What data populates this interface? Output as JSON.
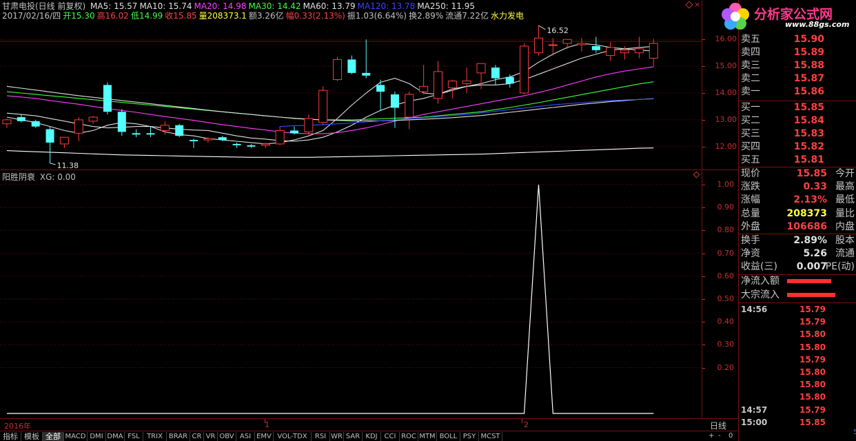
{
  "header": {
    "stock_name": "甘肃电投(日线 前复权)",
    "ma": [
      {
        "label": "MA5: 15.57",
        "color": "#e0e0e0"
      },
      {
        "label": "MA10: 15.74",
        "color": "#e0e0e0"
      },
      {
        "label": "MA20: 14.98",
        "color": "#ff40ff"
      },
      {
        "label": "MA30: 14.42",
        "color": "#40ff40"
      },
      {
        "label": "MA60: 13.79",
        "color": "#e0e0e0"
      },
      {
        "label": "MA120: 13.78",
        "color": "#4040ff"
      },
      {
        "label": "MA250: 11.95",
        "color": "#e0e0e0"
      }
    ],
    "line2": [
      {
        "label": "2017/02/16/四",
        "color": "#c0c0c0"
      },
      {
        "label": "开15.30",
        "color": "#40ff40"
      },
      {
        "label": "高16.02",
        "color": "#ff4040"
      },
      {
        "label": "低14.99",
        "color": "#40ff40"
      },
      {
        "label": "收15.85",
        "color": "#ff4040"
      },
      {
        "label": "量208373.1",
        "color": "#ffff40"
      },
      {
        "label": "额3.26亿",
        "color": "#c0c0c0"
      },
      {
        "label": "幅0.33(2.13%)",
        "color": "#ff4040"
      },
      {
        "label": "振1.03(6.64%)",
        "color": "#c0c0c0"
      },
      {
        "label": "换2.89%",
        "color": "#c0c0c0"
      },
      {
        "label": "流通7.22亿",
        "color": "#c0c0c0"
      },
      {
        "label": "水力发电",
        "color": "#ffff40"
      }
    ]
  },
  "main_chart": {
    "y_ticks": [
      "16.00",
      "15.00",
      "14.00",
      "13.00",
      "12.00"
    ],
    "y_range": [
      11.3,
      16.7
    ],
    "max_label": "16.52",
    "min_label": "11.38",
    "candles": [
      {
        "o": 12.85,
        "h": 13.05,
        "l": 12.7,
        "c": 13.0
      },
      {
        "o": 13.1,
        "h": 13.2,
        "l": 12.9,
        "c": 12.95
      },
      {
        "o": 12.95,
        "h": 13.0,
        "l": 12.7,
        "c": 12.75
      },
      {
        "o": 12.65,
        "h": 12.75,
        "l": 11.38,
        "c": 12.15
      },
      {
        "o": 12.1,
        "h": 12.3,
        "l": 11.95,
        "c": 12.35
      },
      {
        "o": 12.5,
        "h": 13.1,
        "l": 12.2,
        "c": 13.0
      },
      {
        "o": 12.95,
        "h": 13.15,
        "l": 12.85,
        "c": 13.1
      },
      {
        "o": 14.3,
        "h": 14.4,
        "l": 13.2,
        "c": 13.3
      },
      {
        "o": 13.3,
        "h": 13.4,
        "l": 12.4,
        "c": 12.55
      },
      {
        "o": 12.5,
        "h": 12.65,
        "l": 12.35,
        "c": 12.45
      },
      {
        "o": 12.5,
        "h": 12.75,
        "l": 12.35,
        "c": 12.45
      },
      {
        "o": 12.6,
        "h": 12.95,
        "l": 12.45,
        "c": 12.8
      },
      {
        "o": 12.8,
        "h": 12.85,
        "l": 12.35,
        "c": 12.4
      },
      {
        "o": 12.25,
        "h": 12.3,
        "l": 11.95,
        "c": 12.2
      },
      {
        "o": 12.25,
        "h": 12.35,
        "l": 12.15,
        "c": 12.3
      },
      {
        "o": 12.35,
        "h": 12.4,
        "l": 12.2,
        "c": 12.25
      },
      {
        "o": 12.1,
        "h": 12.15,
        "l": 11.95,
        "c": 12.05
      },
      {
        "o": 12.05,
        "h": 12.1,
        "l": 11.95,
        "c": 12.0
      },
      {
        "o": 12.05,
        "h": 12.15,
        "l": 11.95,
        "c": 12.1
      },
      {
        "o": 12.1,
        "h": 12.75,
        "l": 12.05,
        "c": 12.6
      },
      {
        "o": 12.6,
        "h": 12.75,
        "l": 12.45,
        "c": 12.5
      },
      {
        "o": 12.55,
        "h": 13.2,
        "l": 12.45,
        "c": 13.05
      },
      {
        "o": 12.9,
        "h": 14.25,
        "l": 12.8,
        "c": 14.1
      },
      {
        "o": 14.5,
        "h": 15.35,
        "l": 14.45,
        "c": 15.25
      },
      {
        "o": 15.25,
        "h": 15.4,
        "l": 14.7,
        "c": 14.75
      },
      {
        "o": 14.75,
        "h": 16.0,
        "l": 14.55,
        "c": 14.65
      },
      {
        "o": 14.3,
        "h": 14.5,
        "l": 13.35,
        "c": 14.05
      },
      {
        "o": 13.95,
        "h": 14.05,
        "l": 12.7,
        "c": 13.45
      },
      {
        "o": 13.1,
        "h": 14.05,
        "l": 12.65,
        "c": 13.95
      },
      {
        "o": 14.05,
        "h": 15.05,
        "l": 13.95,
        "c": 14.25
      },
      {
        "o": 13.8,
        "h": 15.2,
        "l": 13.6,
        "c": 14.8
      },
      {
        "o": 14.2,
        "h": 14.5,
        "l": 13.8,
        "c": 14.45
      },
      {
        "o": 14.35,
        "h": 14.95,
        "l": 14.0,
        "c": 14.45
      },
      {
        "o": 14.75,
        "h": 15.1,
        "l": 14.15,
        "c": 15.1
      },
      {
        "o": 14.95,
        "h": 15.05,
        "l": 14.3,
        "c": 14.55
      },
      {
        "o": 14.6,
        "h": 14.7,
        "l": 14.2,
        "c": 14.35
      },
      {
        "o": 14.0,
        "h": 15.85,
        "l": 13.95,
        "c": 15.75
      },
      {
        "o": 15.5,
        "h": 16.52,
        "l": 15.4,
        "c": 16.05
      },
      {
        "o": 15.8,
        "h": 16.05,
        "l": 15.4,
        "c": 15.8
      },
      {
        "o": 15.85,
        "h": 15.95,
        "l": 15.65,
        "c": 16.0
      },
      {
        "o": 15.8,
        "h": 16.05,
        "l": 15.55,
        "c": 15.85
      },
      {
        "o": 15.75,
        "h": 16.1,
        "l": 15.5,
        "c": 15.6
      },
      {
        "o": 15.4,
        "h": 15.9,
        "l": 15.2,
        "c": 15.7
      },
      {
        "o": 15.5,
        "h": 15.75,
        "l": 15.25,
        "c": 15.6
      },
      {
        "o": 15.5,
        "h": 16.1,
        "l": 15.3,
        "c": 15.65
      },
      {
        "o": 15.3,
        "h": 16.02,
        "l": 14.99,
        "c": 15.85
      }
    ],
    "ma_lines": [
      {
        "name": "MA5",
        "color": "#e0e0e0",
        "values": [
          13.1,
          13.0,
          12.9,
          12.75,
          12.6,
          12.5,
          12.6,
          12.8,
          12.9,
          12.85,
          12.75,
          12.55,
          12.45,
          12.4,
          12.3,
          12.25,
          12.2,
          12.15,
          12.1,
          12.15,
          12.25,
          12.4,
          12.6,
          13.05,
          13.55,
          14.0,
          14.4,
          14.55,
          14.35,
          14.0,
          13.95,
          14.15,
          14.25,
          14.35,
          14.5,
          14.6,
          14.8,
          15.15,
          15.45,
          15.7,
          15.85,
          15.8,
          15.7,
          15.65,
          15.6,
          15.57
        ]
      },
      {
        "name": "MA10",
        "color": "#e0e0e0",
        "values": [
          13.25,
          13.2,
          13.15,
          13.05,
          12.95,
          12.85,
          12.75,
          12.7,
          12.72,
          12.75,
          12.75,
          12.7,
          12.65,
          12.62,
          12.6,
          12.5,
          12.4,
          12.32,
          12.28,
          12.22,
          12.2,
          12.25,
          12.35,
          12.55,
          12.8,
          13.1,
          13.35,
          13.55,
          13.7,
          13.8,
          13.95,
          14.1,
          14.25,
          14.3,
          14.3,
          14.35,
          14.5,
          14.7,
          14.9,
          15.1,
          15.3,
          15.45,
          15.6,
          15.65,
          15.7,
          15.74
        ]
      },
      {
        "name": "MA20",
        "color": "#ff40ff",
        "values": [
          13.9,
          13.85,
          13.8,
          13.72,
          13.65,
          13.58,
          13.5,
          13.42,
          13.35,
          13.28,
          13.2,
          13.12,
          13.05,
          12.98,
          12.9,
          12.82,
          12.75,
          12.68,
          12.62,
          12.55,
          12.5,
          12.48,
          12.48,
          12.52,
          12.6,
          12.7,
          12.82,
          12.95,
          13.08,
          13.2,
          13.3,
          13.4,
          13.5,
          13.6,
          13.7,
          13.8,
          13.9,
          14.02,
          14.15,
          14.3,
          14.45,
          14.6,
          14.72,
          14.82,
          14.9,
          14.98
        ]
      },
      {
        "name": "MA30",
        "color": "#40ff40",
        "values": [
          14.05,
          14.0,
          13.95,
          13.9,
          13.85,
          13.8,
          13.75,
          13.7,
          13.65,
          13.6,
          13.55,
          13.5,
          13.45,
          13.4,
          13.35,
          13.3,
          13.25,
          13.2,
          13.15,
          13.1,
          13.05,
          13.02,
          13.0,
          13.0,
          13.0,
          13.02,
          13.04,
          13.06,
          13.08,
          13.1,
          13.15,
          13.2,
          13.25,
          13.3,
          13.38,
          13.46,
          13.55,
          13.64,
          13.74,
          13.84,
          13.94,
          14.04,
          14.14,
          14.24,
          14.34,
          14.42
        ]
      },
      {
        "name": "MA60",
        "color": "#e0e0e0",
        "values": [
          14.25,
          14.18,
          14.11,
          14.04,
          13.97,
          13.9,
          13.84,
          13.78,
          13.72,
          13.66,
          13.6,
          13.54,
          13.48,
          13.42,
          13.36,
          13.3,
          13.25,
          13.2,
          13.15,
          13.1,
          13.06,
          13.02,
          13.0,
          12.98,
          12.96,
          12.96,
          12.96,
          12.98,
          13.0,
          13.02,
          13.05,
          13.08,
          13.12,
          13.16,
          13.22,
          13.28,
          13.34,
          13.4,
          13.46,
          13.52,
          13.58,
          13.63,
          13.68,
          13.72,
          13.76,
          13.79
        ]
      },
      {
        "name": "MA120",
        "color": "#3050ff",
        "values": [
          null,
          null,
          null,
          null,
          null,
          null,
          null,
          null,
          null,
          null,
          null,
          null,
          null,
          null,
          null,
          null,
          null,
          null,
          null,
          12.75,
          12.78,
          12.8,
          12.82,
          12.85,
          12.88,
          12.92,
          12.96,
          13.0,
          13.04,
          13.08,
          13.12,
          13.16,
          13.2,
          13.26,
          13.32,
          13.38,
          13.44,
          13.5,
          13.56,
          13.6,
          13.64,
          13.68,
          13.72,
          13.74,
          13.76,
          13.78
        ]
      },
      {
        "name": "MA250",
        "color": "#ffffff",
        "values": [
          11.85,
          11.83,
          11.81,
          11.79,
          11.77,
          11.75,
          11.73,
          11.71,
          11.69,
          11.68,
          11.67,
          11.66,
          11.65,
          11.64,
          11.63,
          11.62,
          11.61,
          11.6,
          11.6,
          11.6,
          11.6,
          11.6,
          11.61,
          11.62,
          11.63,
          11.64,
          11.65,
          11.66,
          11.67,
          11.68,
          11.69,
          11.7,
          11.71,
          11.72,
          11.74,
          11.76,
          11.78,
          11.8,
          11.82,
          11.84,
          11.86,
          11.88,
          11.9,
          11.92,
          11.94,
          11.95
        ]
      }
    ]
  },
  "indicator": {
    "title": "阳胜阴衰",
    "xg_label": "XG: 0.00",
    "y_ticks": [
      "1.00",
      "0.90",
      "0.80",
      "0.70",
      "0.60",
      "0.50",
      "0.40",
      "0.30",
      "0.20"
    ],
    "y_range": [
      0,
      1.0
    ],
    "values": [
      0,
      0,
      0,
      0,
      0,
      0,
      0,
      0,
      0,
      0,
      0,
      0,
      0,
      0,
      0,
      0,
      0,
      0,
      0,
      0,
      0,
      0,
      0,
      0,
      0,
      0,
      0,
      0,
      0,
      0,
      0,
      0,
      0,
      0,
      0,
      0,
      0,
      1,
      0,
      0,
      0,
      0,
      0,
      0,
      0,
      0
    ]
  },
  "x_axis": {
    "labels": [
      "2016年",
      "1",
      "2"
    ],
    "period": "日线"
  },
  "tabs": [
    "指标",
    "模板",
    "全部",
    "MACD",
    "DMI",
    "DMA",
    "FSL",
    "TRIX",
    "BRAR",
    "CR",
    "VR",
    "OBV",
    "ASI",
    "EMV",
    "VOL-TDX",
    "RSI",
    "WR",
    "SAR",
    "KDJ",
    "CCI",
    "ROC",
    "MTM",
    "BOLL",
    "PSY",
    "MCST"
  ],
  "active_tab": "全部",
  "logo": {
    "text": "分析家公式网",
    "url": "www.88gs.com"
  },
  "order_book": {
    "asks": [
      {
        "label": "卖五",
        "price": "15.90"
      },
      {
        "label": "卖四",
        "price": "15.89"
      },
      {
        "label": "卖三",
        "price": "15.88"
      },
      {
        "label": "卖二",
        "price": "15.87"
      },
      {
        "label": "卖一",
        "price": "15.86"
      }
    ],
    "bids": [
      {
        "label": "买一",
        "price": "15.85"
      },
      {
        "label": "买二",
        "price": "15.84"
      },
      {
        "label": "买三",
        "price": "15.83"
      },
      {
        "label": "买四",
        "price": "15.82"
      },
      {
        "label": "买五",
        "price": "15.81"
      }
    ]
  },
  "quote": [
    {
      "label": "现价",
      "value": "15.85",
      "color": "#ff4040",
      "label2": "今开"
    },
    {
      "label": "涨跌",
      "value": "0.33",
      "color": "#ff4040",
      "label2": "最高"
    },
    {
      "label": "涨幅",
      "value": "2.13%",
      "color": "#ff4040",
      "label2": "最低"
    },
    {
      "label": "总量",
      "value": "208373",
      "color": "#ffff40",
      "label2": "量比"
    },
    {
      "label": "外盘",
      "value": "106686",
      "color": "#ff4040",
      "label2": "内盘"
    }
  ],
  "quote2": [
    {
      "label": "换手",
      "value": "2.89%",
      "color": "#e0e0e0",
      "label2": "股本"
    },
    {
      "label": "净资",
      "value": "5.26",
      "color": "#e0e0e0",
      "label2": "流通"
    },
    {
      "label": "收益(三)",
      "value": "0.007",
      "color": "#e0e0e0",
      "label2": "PE(动)"
    }
  ],
  "flows": [
    {
      "label": "净流入额"
    },
    {
      "label": "大宗流入"
    }
  ],
  "ticks": [
    {
      "time": "14:56",
      "price": "15.79"
    },
    {
      "time": "",
      "price": "15.79"
    },
    {
      "time": "",
      "price": "15.80"
    },
    {
      "time": "",
      "price": "15.80"
    },
    {
      "time": "",
      "price": "15.79"
    },
    {
      "time": "",
      "price": "15.80"
    },
    {
      "time": "",
      "price": "15.80"
    },
    {
      "time": "",
      "price": "15.80"
    },
    {
      "time": "14:57",
      "price": "15.79"
    },
    {
      "time": "15:00",
      "price": "15.85"
    }
  ]
}
